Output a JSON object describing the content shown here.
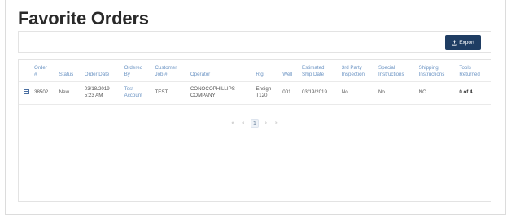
{
  "page": {
    "title": "Favorite Orders",
    "export_label": "Export"
  },
  "table": {
    "headers": {
      "order": [
        "Order",
        "#"
      ],
      "status": "Status",
      "order_date": "Order Date",
      "ordered_by": [
        "Ordered",
        "By"
      ],
      "customer_job": [
        "Customer",
        "Job #"
      ],
      "operator": "Operator",
      "rig": "Rig",
      "well": "Well",
      "ship_date": [
        "Estimated",
        "Ship Date"
      ],
      "third_party": [
        "3rd Party",
        "Inspection"
      ],
      "special": [
        "Special",
        "Instructions"
      ],
      "shipping": [
        "Shipping",
        "Instructions"
      ],
      "tools": [
        "Tools",
        "Returned"
      ]
    },
    "rows": [
      {
        "order": "38502",
        "status": "New",
        "order_date": [
          "03/18/2019",
          "5:23 AM"
        ],
        "ordered_by": [
          "Test",
          "Account"
        ],
        "customer_job": "TEST",
        "operator": [
          "CONOCOPHILLIPS",
          "COMPANY"
        ],
        "rig": [
          "Ensign",
          "T120"
        ],
        "well": "001",
        "ship_date": "03/19/2019",
        "third_party": "No",
        "special": "No",
        "shipping": "NO",
        "tools": "0 of 4"
      }
    ]
  },
  "pager": {
    "first": "«",
    "prev": "‹",
    "current": "1",
    "next": "›",
    "last": "»"
  },
  "colors": {
    "accent": "#6a93c3",
    "button": "#1f3d63"
  }
}
